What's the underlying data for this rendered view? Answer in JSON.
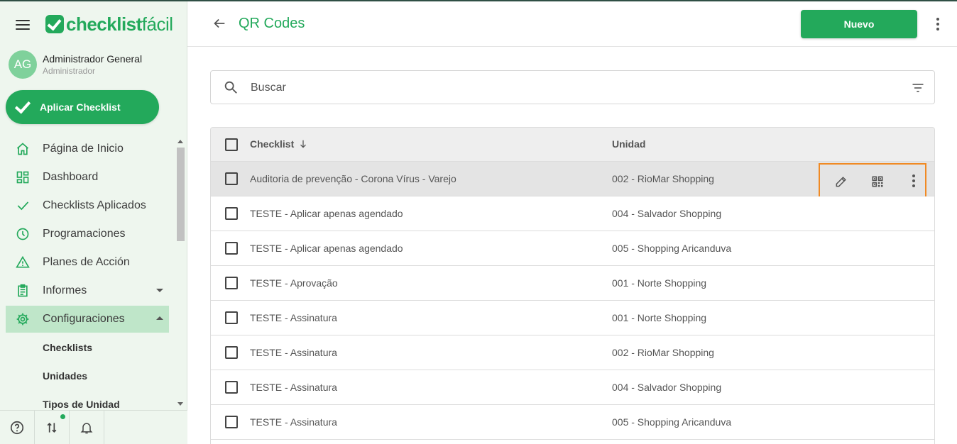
{
  "app": {
    "brand_bold": "checklist",
    "brand_light": "fácil"
  },
  "user": {
    "initials": "AG",
    "name": "Administrador General",
    "role": "Administrador"
  },
  "sidebar": {
    "apply_label": "Aplicar Checklist",
    "items": [
      {
        "label": "Página de Inicio",
        "icon": "home-icon"
      },
      {
        "label": "Dashboard",
        "icon": "dashboard-icon"
      },
      {
        "label": "Checklists Aplicados",
        "icon": "check-icon"
      },
      {
        "label": "Programaciones",
        "icon": "clock-icon"
      },
      {
        "label": "Planes de Acción",
        "icon": "warning-icon"
      },
      {
        "label": "Informes",
        "icon": "clipboard-icon"
      },
      {
        "label": "Configuraciones",
        "icon": "gear-icon"
      }
    ],
    "sub_items": [
      "Checklists",
      "Unidades",
      "Tipos de Unidad"
    ]
  },
  "header": {
    "title": "QR Codes",
    "new_label": "Nuevo"
  },
  "search": {
    "placeholder": "Buscar"
  },
  "table": {
    "headers": {
      "checklist": "Checklist",
      "unit": "Unidad"
    },
    "rows": [
      {
        "checklist": "Auditoria de prevenção - Corona Vírus - Varejo",
        "unit": "002 - RioMar Shopping"
      },
      {
        "checklist": "TESTE - Aplicar apenas agendado",
        "unit": "004 - Salvador Shopping"
      },
      {
        "checklist": "TESTE - Aplicar apenas agendado",
        "unit": "005 - Shopping Aricanduva"
      },
      {
        "checklist": "TESTE - Aprovação",
        "unit": "001 - Norte Shopping"
      },
      {
        "checklist": "TESTE - Assinatura",
        "unit": "001 - Norte Shopping"
      },
      {
        "checklist": "TESTE - Assinatura",
        "unit": "002 - RioMar Shopping"
      },
      {
        "checklist": "TESTE - Assinatura",
        "unit": "004 - Salvador Shopping"
      },
      {
        "checklist": "TESTE - Assinatura",
        "unit": "005 - Shopping Aricanduva"
      }
    ]
  },
  "colors": {
    "brand": "#23a95b",
    "highlight": "#f08a24",
    "sidebar_bg": "#eef6ee"
  }
}
